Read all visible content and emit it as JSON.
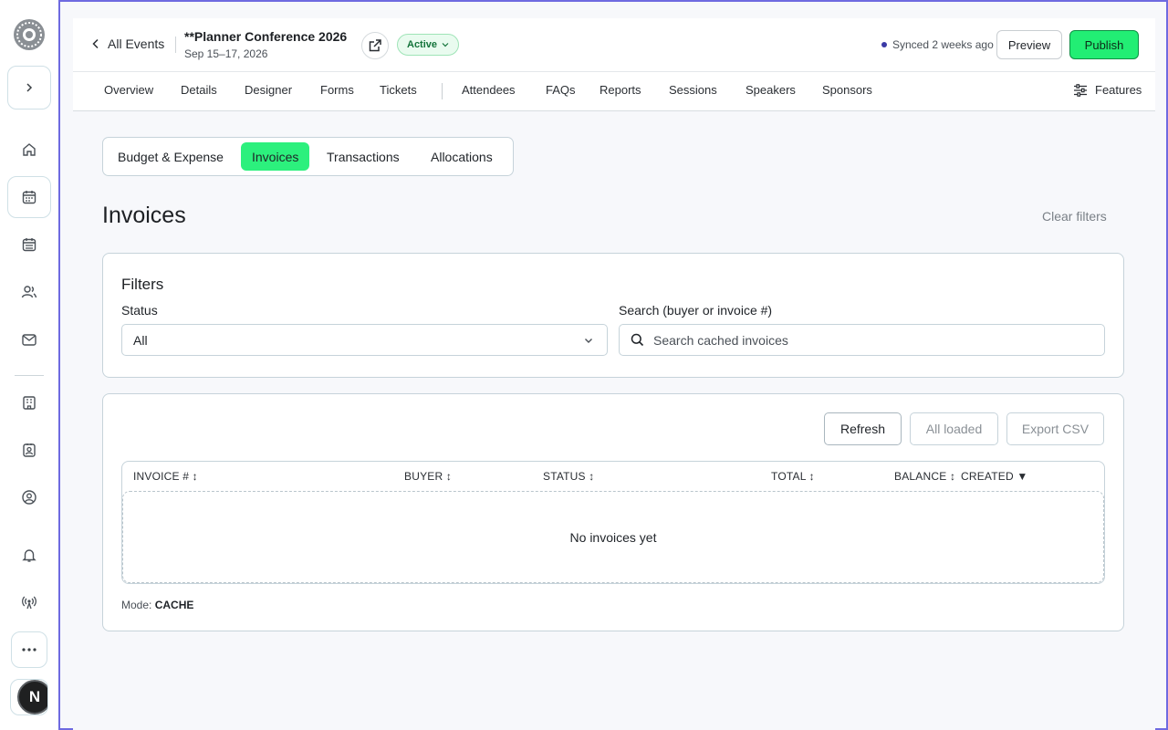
{
  "header": {
    "back_label": "All Events",
    "event_title": "**Planner Conference 2026",
    "event_date": "Sep 15–17, 2026",
    "status": "Active",
    "synced_text": "Synced 2 weeks ago",
    "preview_label": "Preview",
    "publish_label": "Publish"
  },
  "nav_tabs": [
    "Overview",
    "Details",
    "Designer",
    "Forms",
    "Tickets",
    "Attendees",
    "FAQs",
    "Reports",
    "Sessions",
    "Speakers",
    "Sponsors"
  ],
  "features_label": "Features",
  "sub_tabs": [
    "Budget & Expense",
    "Invoices",
    "Transactions",
    "Allocations"
  ],
  "active_sub_tab": "Invoices",
  "page_title": "Invoices",
  "clear_filters_label": "Clear filters",
  "filters": {
    "title": "Filters",
    "status_label": "Status",
    "status_value": "All",
    "search_label": "Search (buyer or invoice #)",
    "search_placeholder": "Search cached invoices",
    "search_value": ""
  },
  "toolbar": {
    "refresh_label": "Refresh",
    "all_loaded_label": "All loaded",
    "export_label": "Export CSV"
  },
  "table": {
    "columns": [
      "INVOICE # ↕",
      "BUYER ↕",
      "STATUS ↕",
      "TOTAL ↕",
      "BALANCE ↕",
      "CREATED ▼"
    ],
    "empty_text": "No invoices yet"
  },
  "mode": {
    "label": "Mode:",
    "value": "CACHE"
  },
  "avatar_initial": "N",
  "colors": {
    "accent": "#22ee74",
    "frame": "#6e6ae0",
    "status_bg": "#e9fbef",
    "status_text": "#13733a"
  }
}
